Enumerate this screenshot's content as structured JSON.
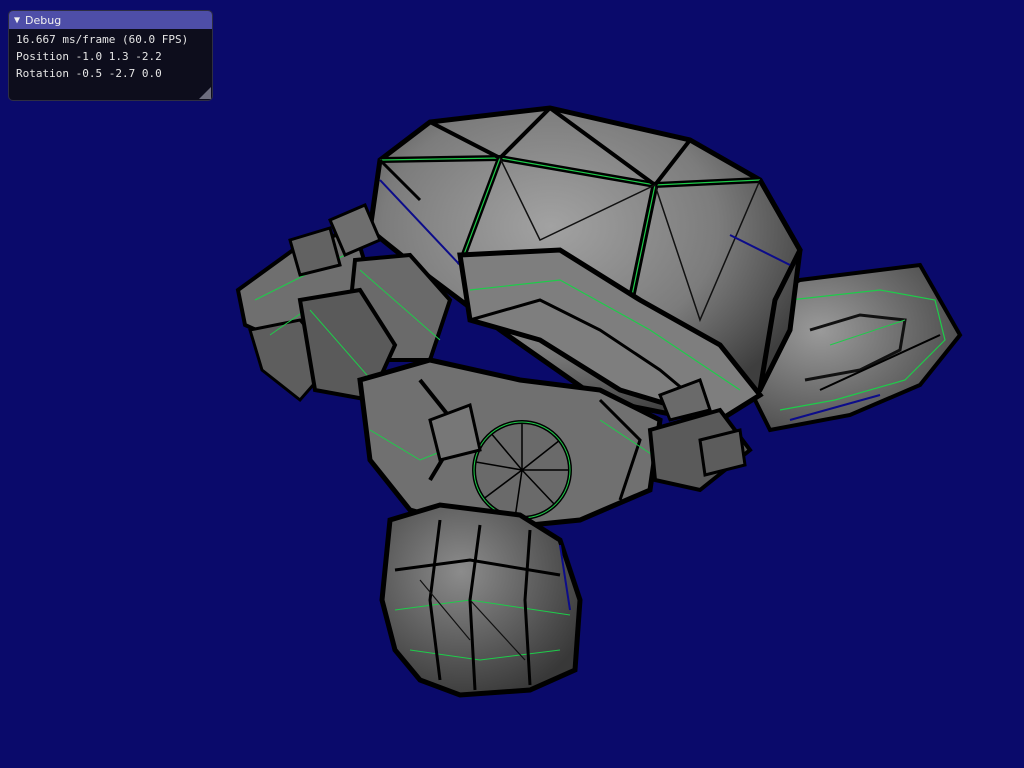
{
  "debug_window": {
    "title": "Debug",
    "collapse_arrow": "▼",
    "frame_time": "16.667 ms/frame (60.0 FPS)",
    "position": "Position -1.0 1.3 -2.2",
    "rotation": "Rotation -0.5 -2.7 0.0"
  },
  "scene": {
    "background_color": "#0a0a6b",
    "model": "monkey-head-mesh",
    "mesh_fill": "#7a7a7a",
    "edge_color": "#1ecc4a",
    "gap_color": "#000000"
  }
}
